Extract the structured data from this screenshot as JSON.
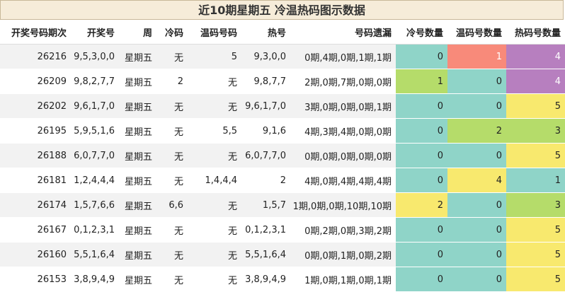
{
  "title": "近10期星期五 冷温热码图示数据",
  "headers": [
    "开奖号码期次",
    "开奖号",
    "周",
    "冷码",
    "温码号码",
    "热号",
    "号码遗漏",
    "冷号数量",
    "温码号数量",
    "热码号数量"
  ],
  "colors": {
    "teal": "#8fd4c8",
    "green": "#b5dc6a",
    "yellow": "#f8e96e",
    "salmon": "#f88a7a",
    "purple": "#b77fbf"
  },
  "rows": [
    {
      "period": "26216",
      "numbers": "9,5,3,0,0",
      "weekday": "星期五",
      "cold": "无",
      "warm": "5",
      "hot": "9,3,0,0",
      "miss": "0期,4期,0期,1期,1期",
      "cold_n": "0",
      "warm_n": "1",
      "hot_n": "4",
      "cold_c": "teal",
      "warm_c": "salmon",
      "hot_c": "purple"
    },
    {
      "period": "26209",
      "numbers": "9,8,2,7,7",
      "weekday": "星期五",
      "cold": "2",
      "warm": "无",
      "hot": "9,8,7,7",
      "miss": "2期,0期,7期,0期,0期",
      "cold_n": "1",
      "warm_n": "0",
      "hot_n": "4",
      "cold_c": "green",
      "warm_c": "teal",
      "hot_c": "purple"
    },
    {
      "period": "26202",
      "numbers": "9,6,1,7,0",
      "weekday": "星期五",
      "cold": "无",
      "warm": "无",
      "hot": "9,6,1,7,0",
      "miss": "3期,0期,0期,0期,1期",
      "cold_n": "0",
      "warm_n": "0",
      "hot_n": "5",
      "cold_c": "teal",
      "warm_c": "teal",
      "hot_c": "yellow"
    },
    {
      "period": "26195",
      "numbers": "5,9,5,1,6",
      "weekday": "星期五",
      "cold": "无",
      "warm": "5,5",
      "hot": "9,1,6",
      "miss": "4期,3期,4期,0期,0期",
      "cold_n": "0",
      "warm_n": "2",
      "hot_n": "3",
      "cold_c": "teal",
      "warm_c": "green",
      "hot_c": "green"
    },
    {
      "period": "26188",
      "numbers": "6,0,7,7,0",
      "weekday": "星期五",
      "cold": "无",
      "warm": "无",
      "hot": "6,0,7,7,0",
      "miss": "0期,0期,0期,0期,0期",
      "cold_n": "0",
      "warm_n": "0",
      "hot_n": "5",
      "cold_c": "teal",
      "warm_c": "teal",
      "hot_c": "yellow"
    },
    {
      "period": "26181",
      "numbers": "1,2,4,4,4",
      "weekday": "星期五",
      "cold": "无",
      "warm": "1,4,4,4",
      "hot": "2",
      "miss": "4期,0期,4期,4期,4期",
      "cold_n": "0",
      "warm_n": "4",
      "hot_n": "1",
      "cold_c": "teal",
      "warm_c": "yellow",
      "hot_c": "teal"
    },
    {
      "period": "26174",
      "numbers": "1,5,7,6,6",
      "weekday": "星期五",
      "cold": "6,6",
      "warm": "无",
      "hot": "1,5,7",
      "miss": "1期,0期,0期,10期,10期",
      "cold_n": "2",
      "warm_n": "0",
      "hot_n": "3",
      "cold_c": "yellow",
      "warm_c": "teal",
      "hot_c": "green"
    },
    {
      "period": "26167",
      "numbers": "0,1,2,3,1",
      "weekday": "星期五",
      "cold": "无",
      "warm": "无",
      "hot": "0,1,2,3,1",
      "miss": "0期,2期,0期,3期,2期",
      "cold_n": "0",
      "warm_n": "0",
      "hot_n": "5",
      "cold_c": "teal",
      "warm_c": "teal",
      "hot_c": "yellow"
    },
    {
      "period": "26160",
      "numbers": "5,5,1,6,4",
      "weekday": "星期五",
      "cold": "无",
      "warm": "无",
      "hot": "5,5,1,6,4",
      "miss": "0期,0期,1期,0期,2期",
      "cold_n": "0",
      "warm_n": "0",
      "hot_n": "5",
      "cold_c": "teal",
      "warm_c": "teal",
      "hot_c": "yellow"
    },
    {
      "period": "26153",
      "numbers": "3,8,9,4,9",
      "weekday": "星期五",
      "cold": "无",
      "warm": "无",
      "hot": "3,8,9,4,9",
      "miss": "1期,0期,1期,0期,1期",
      "cold_n": "0",
      "warm_n": "0",
      "hot_n": "5",
      "cold_c": "teal",
      "warm_c": "teal",
      "hot_c": "yellow"
    }
  ]
}
